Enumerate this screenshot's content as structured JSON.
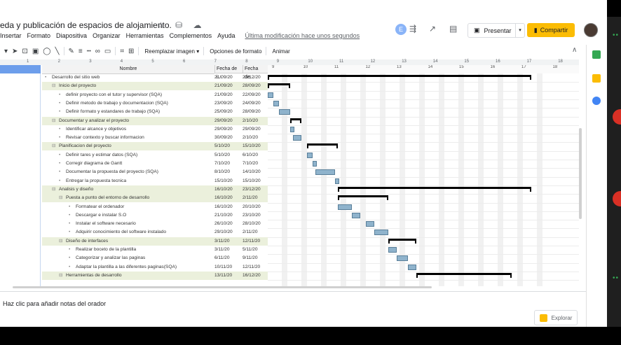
{
  "app": {
    "title": "eda y publicación de espacios de alojamiento.",
    "title_icons": "☆ ⛁ ☁",
    "user_initial": "E"
  },
  "menu": [
    "Insertar",
    "Formato",
    "Diapositiva",
    "Organizar",
    "Herramientas",
    "Complementos",
    "Ayuda"
  ],
  "last_edit": "Última modificación hace unos segundos",
  "header": {
    "present_label": "Presentar",
    "share_label": "Compartir"
  },
  "toolbar": {
    "replace_image": "Reemplazar imagen ▾",
    "format_options": "Opciones de formato",
    "animate": "Animar"
  },
  "ruler_numbers": [
    "1",
    "2",
    "3",
    "4",
    "5",
    "6",
    "7",
    "8",
    "9",
    "10",
    "11",
    "12",
    "13",
    "14",
    "15",
    "16",
    "17",
    "18"
  ],
  "gantt": {
    "col_name": "Nombre",
    "col_start": "Fecha de i...",
    "col_end": "Fecha de...",
    "week_labels": [
      "9",
      "10",
      "11",
      "12",
      "13",
      "14",
      "15",
      "16",
      "17",
      "18"
    ],
    "rows": [
      {
        "name": "Desarrollo del sitio web",
        "start": "21/09/20",
        "end": "23/12/20",
        "level": 0,
        "sum": false
      },
      {
        "name": "Inicio del proyecto",
        "start": "21/09/20",
        "end": "28/09/20",
        "level": 1,
        "sum": true
      },
      {
        "name": "definir proyecto con el tutor y supervisor (SQA)",
        "start": "21/09/20",
        "end": "22/09/20",
        "level": 2,
        "sum": false
      },
      {
        "name": "Definir metodo de trabajo y documentacion (SQA)",
        "start": "23/09/20",
        "end": "24/09/20",
        "level": 2,
        "sum": false
      },
      {
        "name": "Definir formato y estandares de trabajo (SQA)",
        "start": "25/09/20",
        "end": "28/09/20",
        "level": 2,
        "sum": false
      },
      {
        "name": "Documentar y analizar el proyecto",
        "start": "29/09/20",
        "end": "2/10/20",
        "level": 1,
        "sum": true
      },
      {
        "name": "Identificar alcance y objetivos",
        "start": "29/09/20",
        "end": "29/09/20",
        "level": 2,
        "sum": false
      },
      {
        "name": "Revisar contexto y buscar informacion",
        "start": "30/09/20",
        "end": "2/10/20",
        "level": 2,
        "sum": false
      },
      {
        "name": "Planificacion del proyecto",
        "start": "5/10/20",
        "end": "15/10/20",
        "level": 1,
        "sum": true
      },
      {
        "name": "Definir tares y estimar datos (SQA)",
        "start": "5/10/20",
        "end": "6/10/20",
        "level": 2,
        "sum": false
      },
      {
        "name": "Corregir diagrama de Gantt",
        "start": "7/10/20",
        "end": "7/10/20",
        "level": 2,
        "sum": false
      },
      {
        "name": "Documentar la propuesta del proyecto (SQA)",
        "start": "8/10/20",
        "end": "14/10/20",
        "level": 2,
        "sum": false
      },
      {
        "name": "Entregar la propuesta tecnica",
        "start": "15/10/20",
        "end": "15/10/20",
        "level": 2,
        "sum": false
      },
      {
        "name": "Analisis y diseño",
        "start": "16/10/20",
        "end": "23/12/20",
        "level": 1,
        "sum": true
      },
      {
        "name": "Puesta a punto del entorno de desarrollo",
        "start": "16/10/20",
        "end": "2/11/20",
        "level": 2,
        "sum": true
      },
      {
        "name": "Formatear el ordenador",
        "start": "16/10/20",
        "end": "20/10/20",
        "level": 3,
        "sum": false
      },
      {
        "name": "Descargar e instalar S.O",
        "start": "21/10/20",
        "end": "23/10/20",
        "level": 3,
        "sum": false
      },
      {
        "name": "Instalar el software necesario",
        "start": "26/10/20",
        "end": "28/10/20",
        "level": 3,
        "sum": false
      },
      {
        "name": "Adquirir conocimiento del software instalado",
        "start": "29/10/20",
        "end": "2/11/20",
        "level": 3,
        "sum": false
      },
      {
        "name": "Diseño de interfaces",
        "start": "3/11/20",
        "end": "12/11/20",
        "level": 2,
        "sum": true
      },
      {
        "name": "Realizar boceto de la plantilla",
        "start": "3/11/20",
        "end": "5/11/20",
        "level": 3,
        "sum": false
      },
      {
        "name": "Categorizar y analizar las paginas",
        "start": "6/11/20",
        "end": "9/11/20",
        "level": 3,
        "sum": false
      },
      {
        "name": "Adaptar la plantilla a las diferentes paginas(SQA)",
        "start": "10/11/20",
        "end": "12/11/20",
        "level": 3,
        "sum": false
      },
      {
        "name": "Herramientas de desarrollo",
        "start": "13/11/20",
        "end": "16/12/20",
        "level": 2,
        "sum": true
      }
    ]
  },
  "notes": {
    "placeholder": "Haz clic para añadir notas del orador"
  },
  "explore_label": "Explorar"
}
